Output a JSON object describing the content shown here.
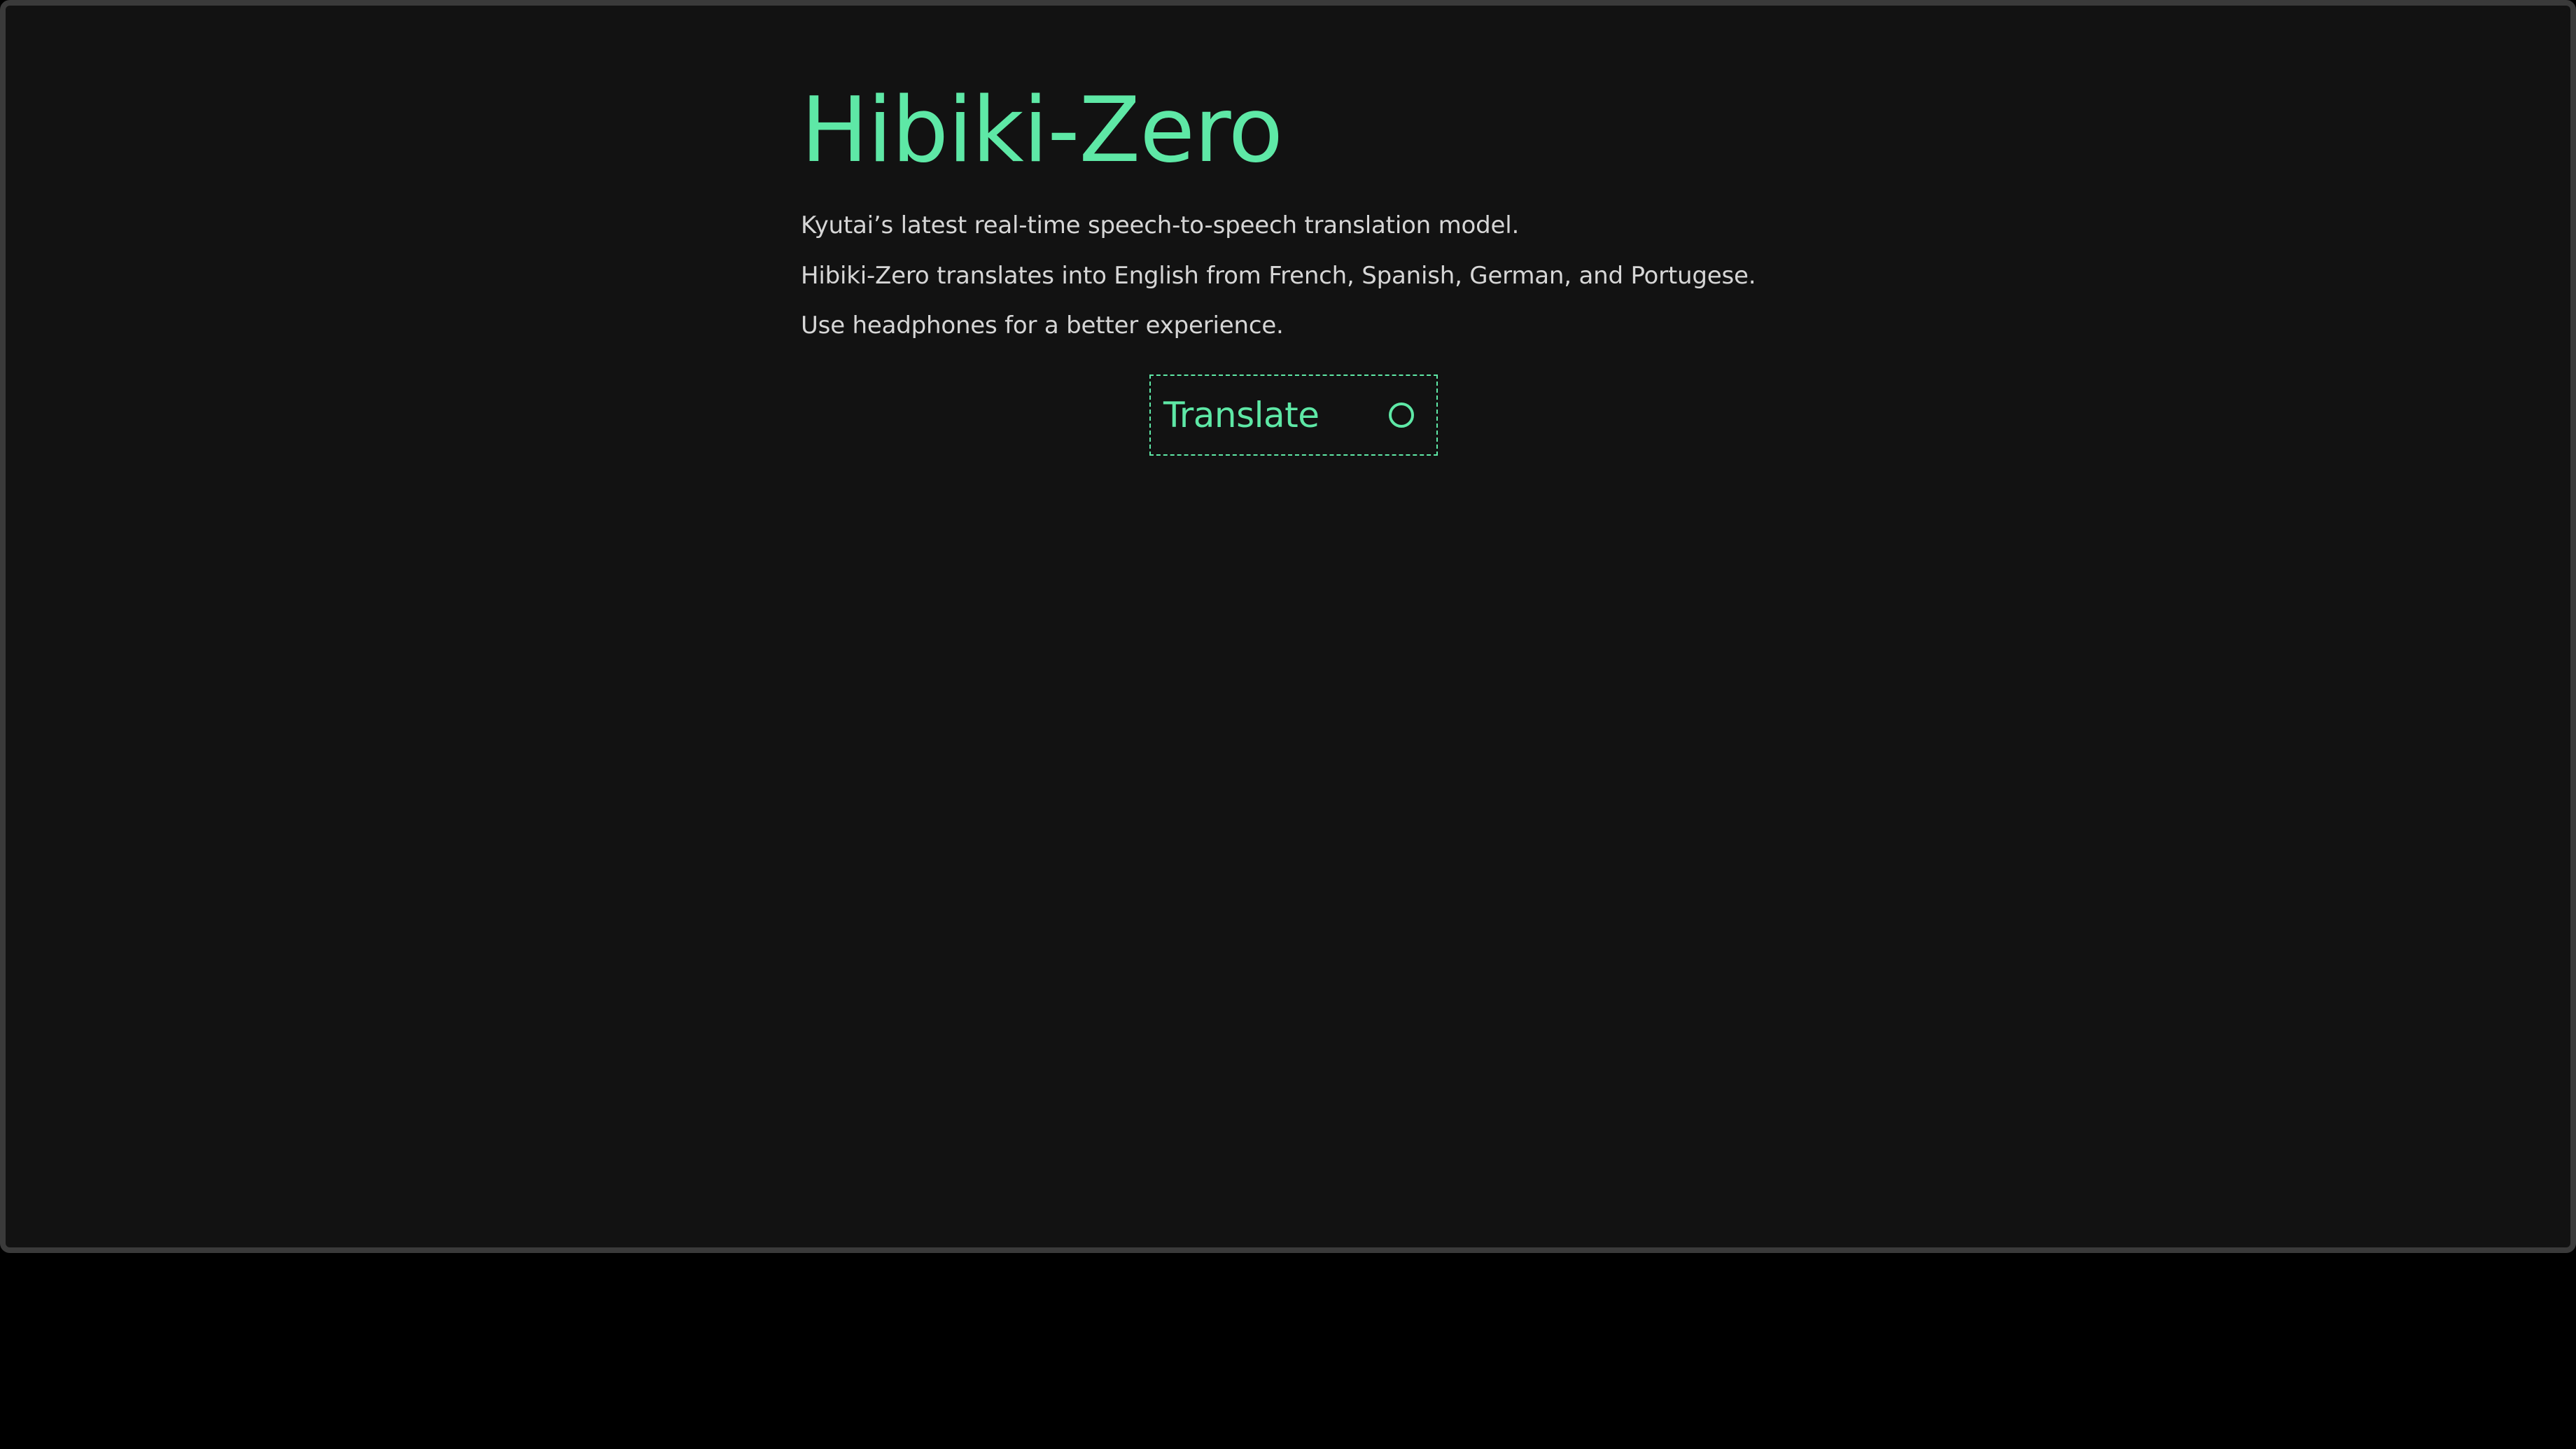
{
  "app": {
    "title": "Hibiki-Zero",
    "accent_color": "#5ee8a6",
    "background_color": "#121212"
  },
  "description": {
    "line1": "Kyutai’s latest real-time speech-to-speech translation model.",
    "line2": "Hibiki-Zero translates into English from French, Spanish, German, and Portugese.",
    "line3": "Use headphones for a better experience."
  },
  "translate_button": {
    "label": "Translate",
    "icon": "record-circle-icon"
  }
}
